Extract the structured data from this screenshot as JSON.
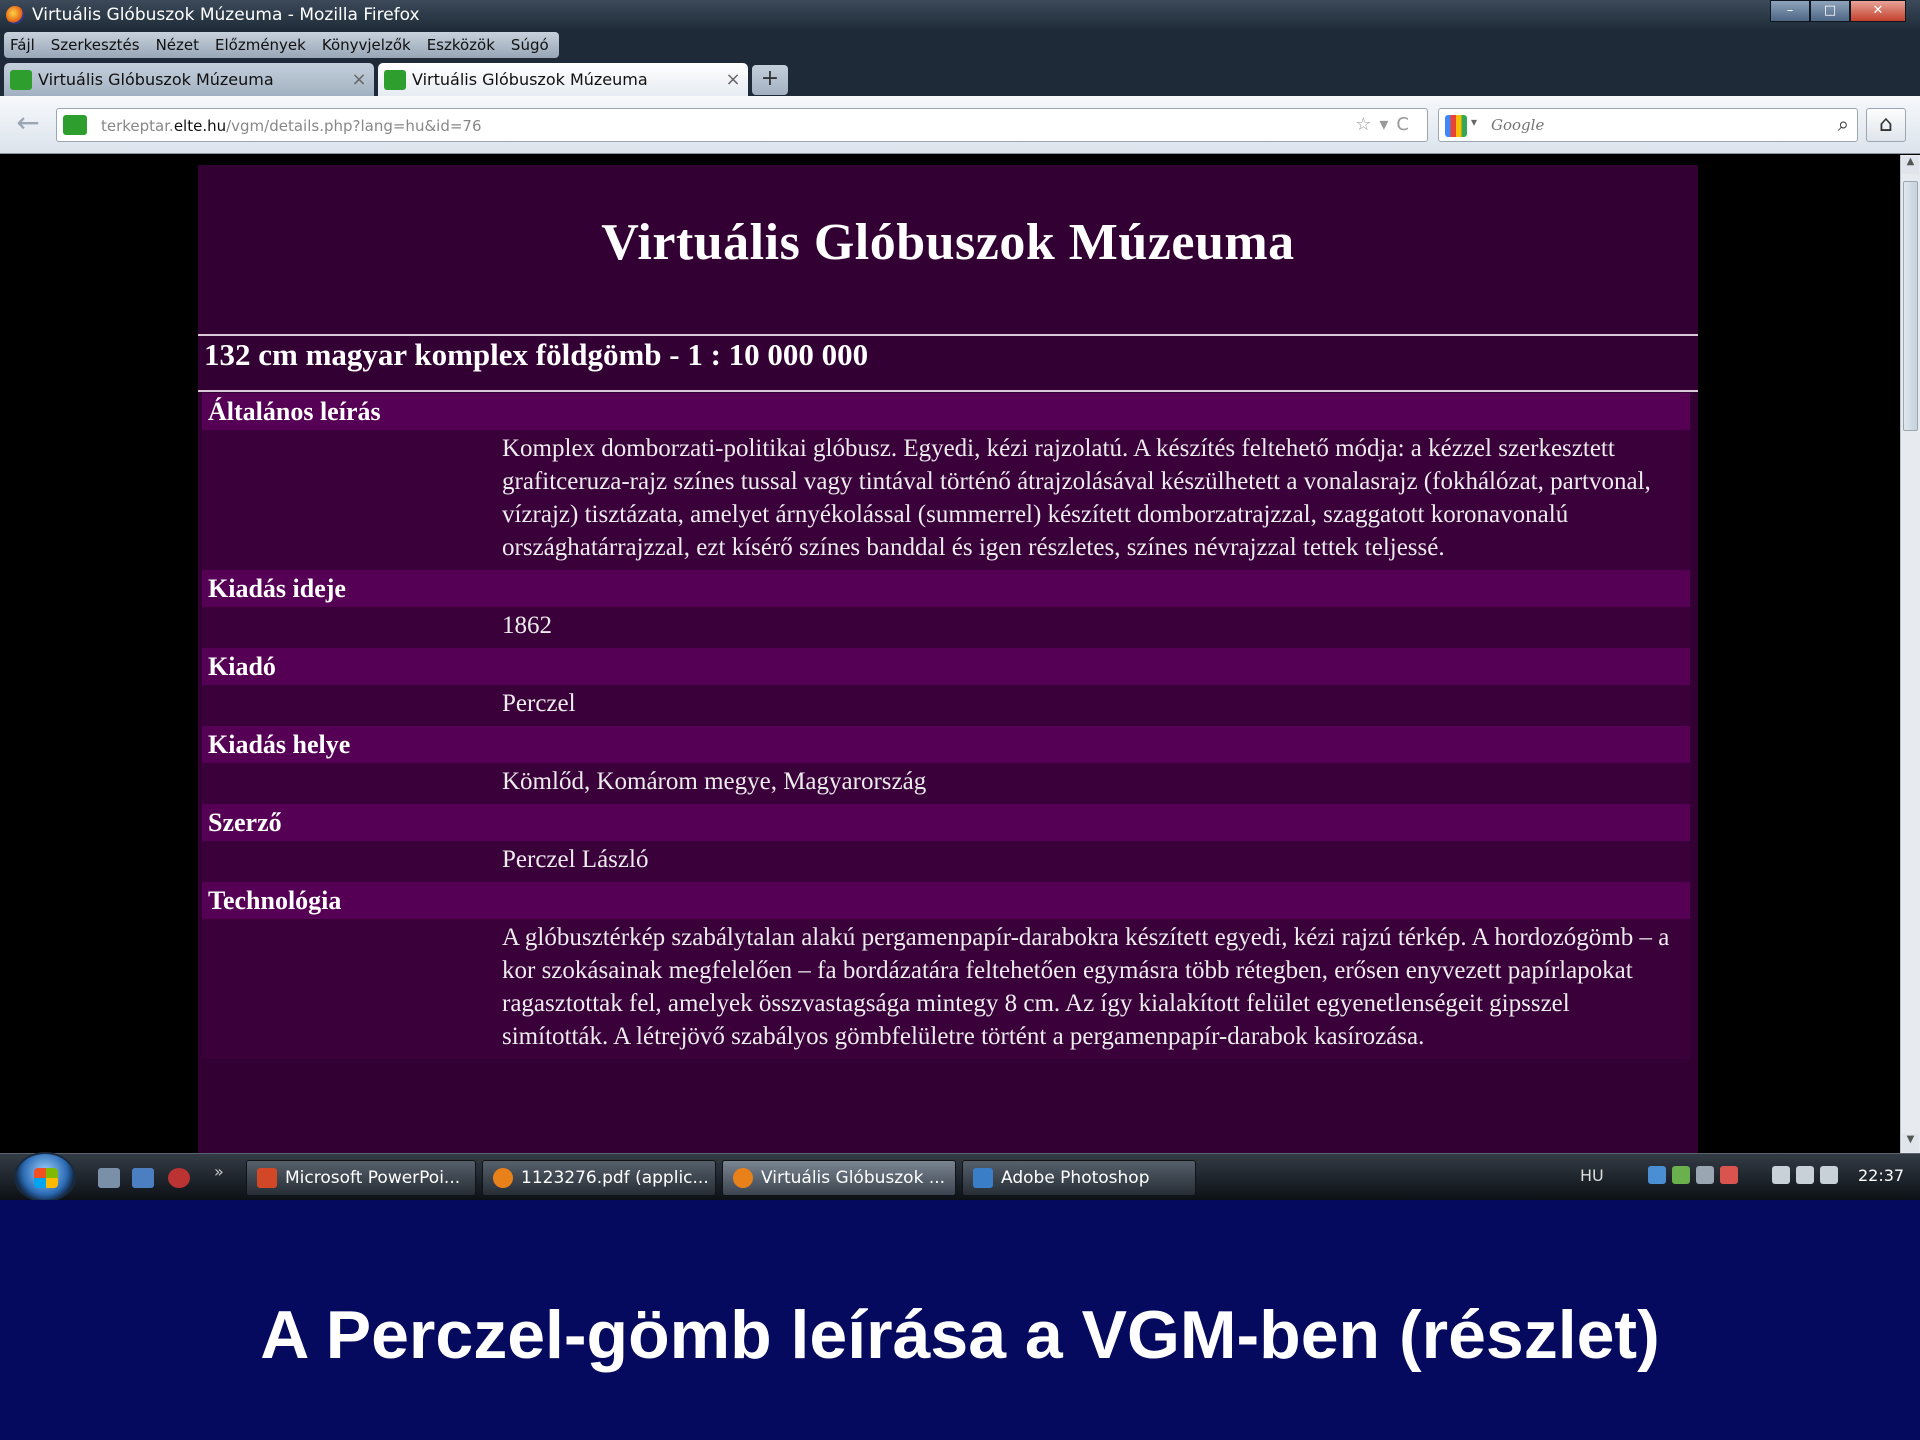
{
  "window": {
    "title": "Virtuális Glóbuszok Múzeuma - Mozilla Firefox",
    "controls": {
      "minimize": "–",
      "maximize": "□",
      "close": "✕"
    }
  },
  "menu": {
    "items": [
      "Fájl",
      "Szerkesztés",
      "Nézet",
      "Előzmények",
      "Könyvjelzők",
      "Eszközök",
      "Súgó"
    ]
  },
  "tabs": [
    {
      "label": "Virtuális Glóbuszok Múzeuma",
      "close": "×"
    },
    {
      "label": "Virtuális Glóbuszok Múzeuma",
      "close": "×"
    }
  ],
  "newtab_label": "+",
  "navbar": {
    "back": "←",
    "url_prefix": "terkeptar.",
    "url_domain": "elte.hu",
    "url_path": "/vgm/details.php?lang=hu&id=76",
    "url_tools": "☆▾C",
    "search_placeholder": "Google",
    "search_icon": "⌕",
    "home_icon": "⌂"
  },
  "page": {
    "site_title": "Virtuális Glóbuszok Múzeuma",
    "record_title": "132 cm magyar komplex földgömb - 1 : 10 000 000",
    "fields": [
      {
        "label": "Általános leírás",
        "value": "Komplex domborzati-politikai glóbusz. Egyedi, kézi rajzolatú. A készítés feltehető módja: a kézzel szerkesztett grafitceruza-rajz színes tussal vagy tintával történő átrajzolásával készülhetett a vonalasrajz (fokhálózat, partvonal, vízrajz) tisztázata, amelyet árnyékolással (summerrel) készített domborzatrajzzal, szaggatott koronavonalú országhatárrajzzal, ezt kísérő színes banddal és igen részletes, színes névrajzzal tettek teljessé."
      },
      {
        "label": "Kiadás ideje",
        "value": "1862"
      },
      {
        "label": "Kiadó",
        "value": "Perczel"
      },
      {
        "label": "Kiadás helye",
        "value": "Kömlőd, Komárom megye, Magyarország"
      },
      {
        "label": "Szerző",
        "value": "Perczel László"
      },
      {
        "label": "Technológia",
        "value": "A glóbusztérkép szabálytalan alakú pergamenpapír-darabokra készített egyedi, kézi rajzú térkép. A hordozógömb – a kor szokásainak megfelelően – fa bordázatára feltehetően egymásra több rétegben, erősen enyvezett papírlapokat ragasztottak fel, amelyek összvastagsága mintegy 8 cm. Az így kialakított felület egyenetlenségeit gipsszel simították. A létrejövő szabályos gömbfelületre történt a pergamenpapír-darabok kasírozása."
      }
    ]
  },
  "scrollbar": {
    "up": "▲",
    "down": "▼"
  },
  "taskbar": {
    "more": "»",
    "tasks": [
      {
        "label": "Microsoft PowerPoi...",
        "color": "#d24726"
      },
      {
        "label": "1123276.pdf (applic...",
        "color": "#e8811a"
      },
      {
        "label": "Virtuális Glóbuszok ...",
        "color": "#e8811a"
      },
      {
        "label": "Adobe Photoshop",
        "color": "#3a7ec8"
      }
    ],
    "language": "HU",
    "clock": "22:37"
  },
  "caption": "A Perczel-gömb leírása a VGM-ben (részlet)",
  "colors": {
    "page_background": "#330033",
    "label_band": "#550055",
    "slide_background": "#050a5e"
  }
}
